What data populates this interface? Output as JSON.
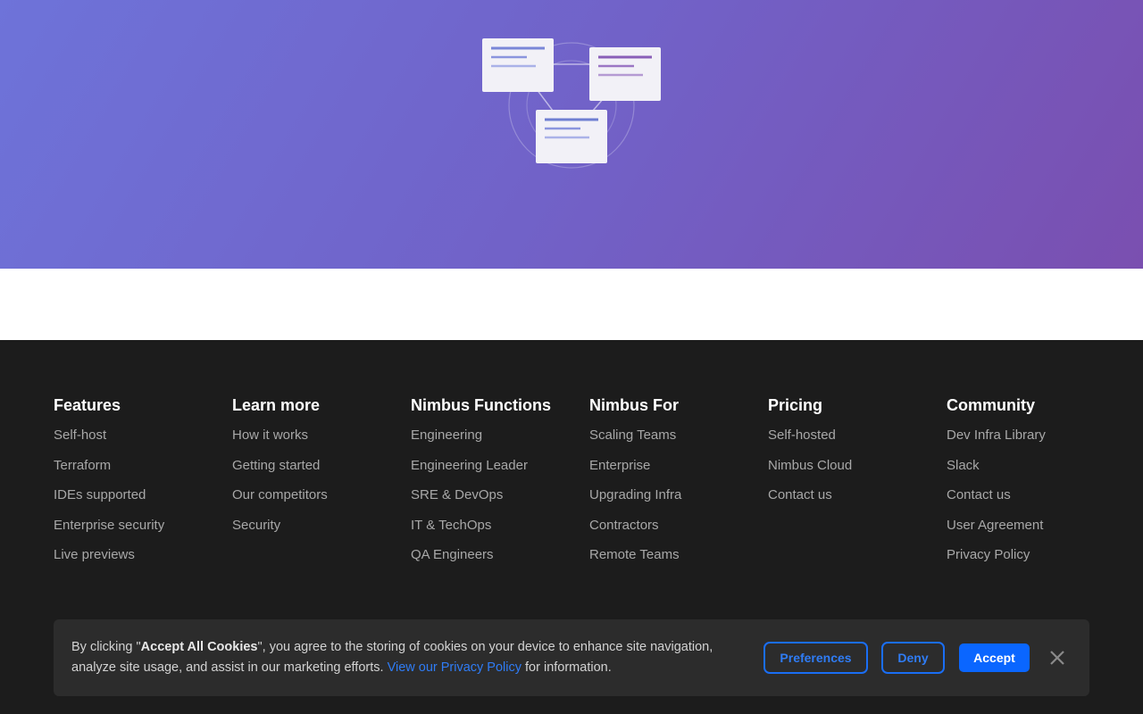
{
  "footer": {
    "columns": [
      {
        "title": "Features",
        "links": [
          "Self-host",
          "Terraform",
          "IDEs supported",
          "Enterprise security",
          "Live previews"
        ]
      },
      {
        "title": "Learn more",
        "links": [
          "How it works",
          "Getting started",
          "Our competitors",
          "Security"
        ]
      },
      {
        "title": "Nimbus Functions",
        "links": [
          "Engineering",
          "Engineering Leader",
          "SRE & DevOps",
          "IT & TechOps",
          "QA Engineers"
        ]
      },
      {
        "title": "Nimbus For",
        "links": [
          "Scaling Teams",
          "Enterprise",
          "Upgrading Infra",
          "Contractors",
          "Remote Teams"
        ]
      },
      {
        "title": "Pricing",
        "links": [
          "Self-hosted",
          "Nimbus Cloud",
          "Contact us"
        ]
      },
      {
        "title": "Community",
        "links": [
          "Dev Infra Library",
          "Slack",
          "Contact us",
          "User Agreement",
          "Privacy Policy"
        ]
      }
    ]
  },
  "cookie": {
    "text_1": "By clicking \"",
    "text_bold": "Accept All Cookies",
    "text_2": "\", you agree to the storing of cookies on your device to enhance site navigation, analyze site usage, and assist in our marketing efforts. ",
    "policy_link": "View our Privacy Policy",
    "text_3": " for information.",
    "preferences_label": "Preferences",
    "deny_label": "Deny",
    "accept_label": "Accept",
    "close_icon": "close-icon"
  },
  "hero": {
    "illustration_icon": "connected-cards-illustration"
  },
  "colors": {
    "accent": "#0a66ff",
    "footer_bg": "#1c1c1c",
    "hero_gradient_start": "#6e73d9",
    "hero_gradient_end": "#7a4fb0"
  }
}
